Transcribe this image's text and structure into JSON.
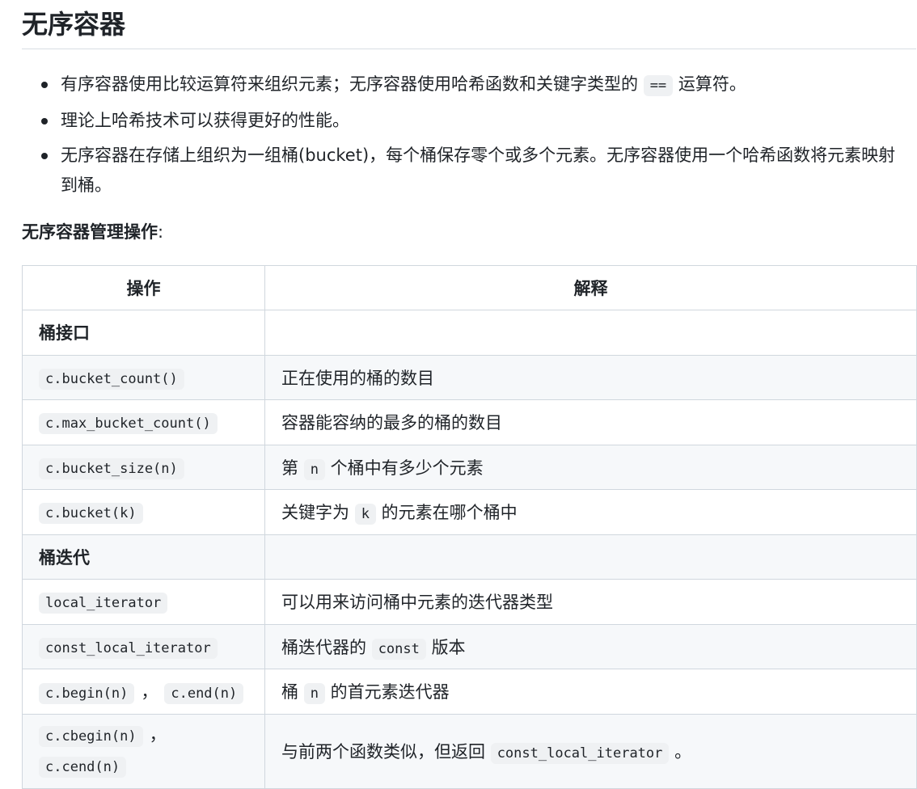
{
  "title": "无序容器",
  "bullets": [
    {
      "before": "有序容器使用比较运算符来组织元素；无序容器使用哈希函数和关键字类型的",
      "code": "==",
      "after": "运算符。"
    },
    {
      "text": "理论上哈希技术可以获得更好的性能。"
    },
    {
      "text": "无序容器在存储上组织为一组桶(bucket)，每个桶保存零个或多个元素。无序容器使用一个哈希函数将元素映射到桶。"
    }
  ],
  "subhead": {
    "bold": "无序容器管理操作",
    "colon": ":"
  },
  "table": {
    "headers": [
      "操作",
      "解释"
    ],
    "rows": [
      {
        "op": "桶接口",
        "desc": ""
      },
      {
        "op": "c.bucket_count()",
        "desc": "正在使用的桶的数目"
      },
      {
        "op": "c.max_bucket_count()",
        "desc": "容器能容纳的最多的桶的数目"
      },
      {
        "op": "c.bucket_size(n)",
        "desc_before": "第",
        "desc_code": "n",
        "desc_after": "个桶中有多少个元素"
      },
      {
        "op": "c.bucket(k)",
        "desc_before": "关键字为",
        "desc_code": "k",
        "desc_after": "的元素在哪个桶中"
      },
      {
        "op": "桶迭代",
        "desc": ""
      },
      {
        "op": "local_iterator",
        "desc": "可以用来访问桶中元素的迭代器类型"
      },
      {
        "op": "const_local_iterator",
        "desc_before": "桶迭代器的",
        "desc_code": "const",
        "desc_after": "版本"
      },
      {
        "op_a": "c.begin(n)",
        "op_sep": "，",
        "op_b": "c.end(n)",
        "desc_before": "桶",
        "desc_code": "n",
        "desc_after": "的首元素迭代器"
      },
      {
        "op_a": "c.cbegin(n)",
        "op_sep": "，",
        "op_b": "c.cend(n)",
        "desc_before": "与前两个函数类似，但返回",
        "desc_code": "const_local_iterator",
        "desc_after": "。"
      }
    ]
  }
}
